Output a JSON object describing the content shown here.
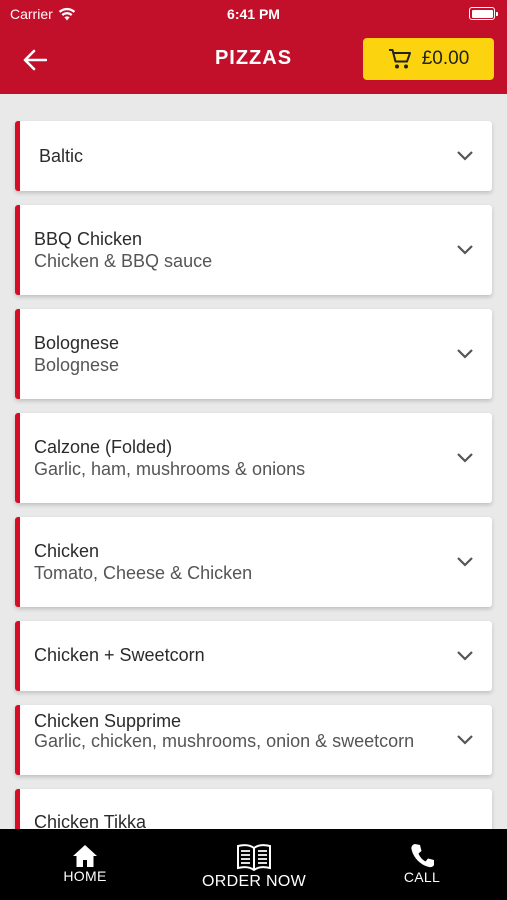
{
  "status_bar": {
    "carrier": "Carrier",
    "time": "6:41 PM"
  },
  "header": {
    "back_icon": "arrow-left-icon",
    "title": "PIZZAS",
    "cart": {
      "icon": "cart-icon",
      "total": "£0.00"
    },
    "color": "#c20f2a",
    "cart_color": "#fbd40f"
  },
  "items": [
    {
      "name": "Baltic",
      "description": ""
    },
    {
      "name": "BBQ Chicken",
      "description": "Chicken & BBQ sauce"
    },
    {
      "name": "Bolognese",
      "description": "Bolognese"
    },
    {
      "name": "Calzone (Folded)",
      "description": "Garlic, ham, mushrooms & onions"
    },
    {
      "name": "Chicken",
      "description": "Tomato, Cheese & Chicken"
    },
    {
      "name": "Chicken + Sweetcorn",
      "description": ""
    },
    {
      "name": "Chicken Supprime",
      "description": "Garlic, chicken, mushrooms, onion & sweetcorn"
    },
    {
      "name": "Chicken Tikka",
      "description": ""
    }
  ],
  "accent_color": "#d50e26",
  "tab_bar": {
    "home": {
      "icon": "home-icon",
      "label": "HOME"
    },
    "order": {
      "icon": "book-icon",
      "label": "ORDER NOW"
    },
    "call": {
      "icon": "phone-icon",
      "label": "CALL"
    }
  }
}
